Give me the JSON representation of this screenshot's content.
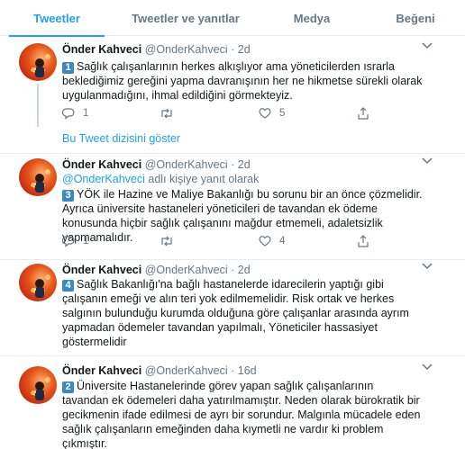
{
  "tabs": [
    {
      "label": "Tweetler"
    },
    {
      "label": "Tweetler ve yanıtlar"
    },
    {
      "label": "Medya"
    },
    {
      "label": "Beğeni"
    }
  ],
  "show_thread": "Bu Tweet dizisini göster",
  "reply_prefix": "adlı kişiye yanıt olarak",
  "reply_handle": "@OnderKahveci",
  "caret_icon": "chevron-down-icon",
  "tweets": [
    {
      "name": "Önder Kahveci",
      "handle": "@OnderKahveci",
      "dot": "·",
      "time": "2d",
      "num": "1",
      "text": "Sağlık çalışanlarının herkes alkışlıyor ama yöneticilerden ısrarla beklediğimiz gereğini yapma davranışının her ne hikmetse sürekli olarak uygulanmadığını, ihmal edildiğini görmekteyiz.",
      "replies": "1",
      "retweets": "",
      "likes": "5"
    },
    {
      "name": "Önder Kahveci",
      "handle": "@OnderKahveci",
      "dot": "·",
      "time": "2d",
      "num": "3",
      "text": "YÖK ile Hazine ve Maliye Bakanlığı bu sorunu bir an önce çözmelidir. Ayrıca üniversite hastaneleri yöneticileri de tavandan ek ödeme konusunda hiçbir sağlık çalışanını mağdur etmemeli, adaletsizlik yapmamalıdır.",
      "replies": "1",
      "retweets": "",
      "likes": "4"
    },
    {
      "name": "Önder Kahveci",
      "handle": "@OnderKahveci",
      "dot": "·",
      "time": "2d",
      "num": "4",
      "text": "Sağlık Bakanlığı'na bağlı hastanelerde idarecilerin yaptığı gibi çalışanın emeği ve alın teri yok edilmemelidir. Risk ortak ve herkes salgının bulunduğu kurumda olduğuna göre çalışanlar arasında ayrım yapmadan ödemeler tavandan yapılmalı, Yöneticiler hassasiyet göstermelidir",
      "replies": "",
      "retweets": "",
      "likes": ""
    },
    {
      "name": "Önder Kahveci",
      "handle": "@OnderKahveci",
      "dot": "·",
      "time": "16d",
      "num": "2",
      "text": "Üniversite Hastanelerinde görev yapan sağlık çalışanlarının tavandan ek ödemeleri daha yatırılmamıştır. Neden olarak bürokratik bir gecikmenin ifade edilmesi de ayrı bir sorundur. Malgınla mücadele eden sağlık çalışanların emeğinden daha kıymetli ne vardır ki problem çıkmıştır.",
      "replies": "",
      "retweets": "",
      "likes": ""
    }
  ]
}
